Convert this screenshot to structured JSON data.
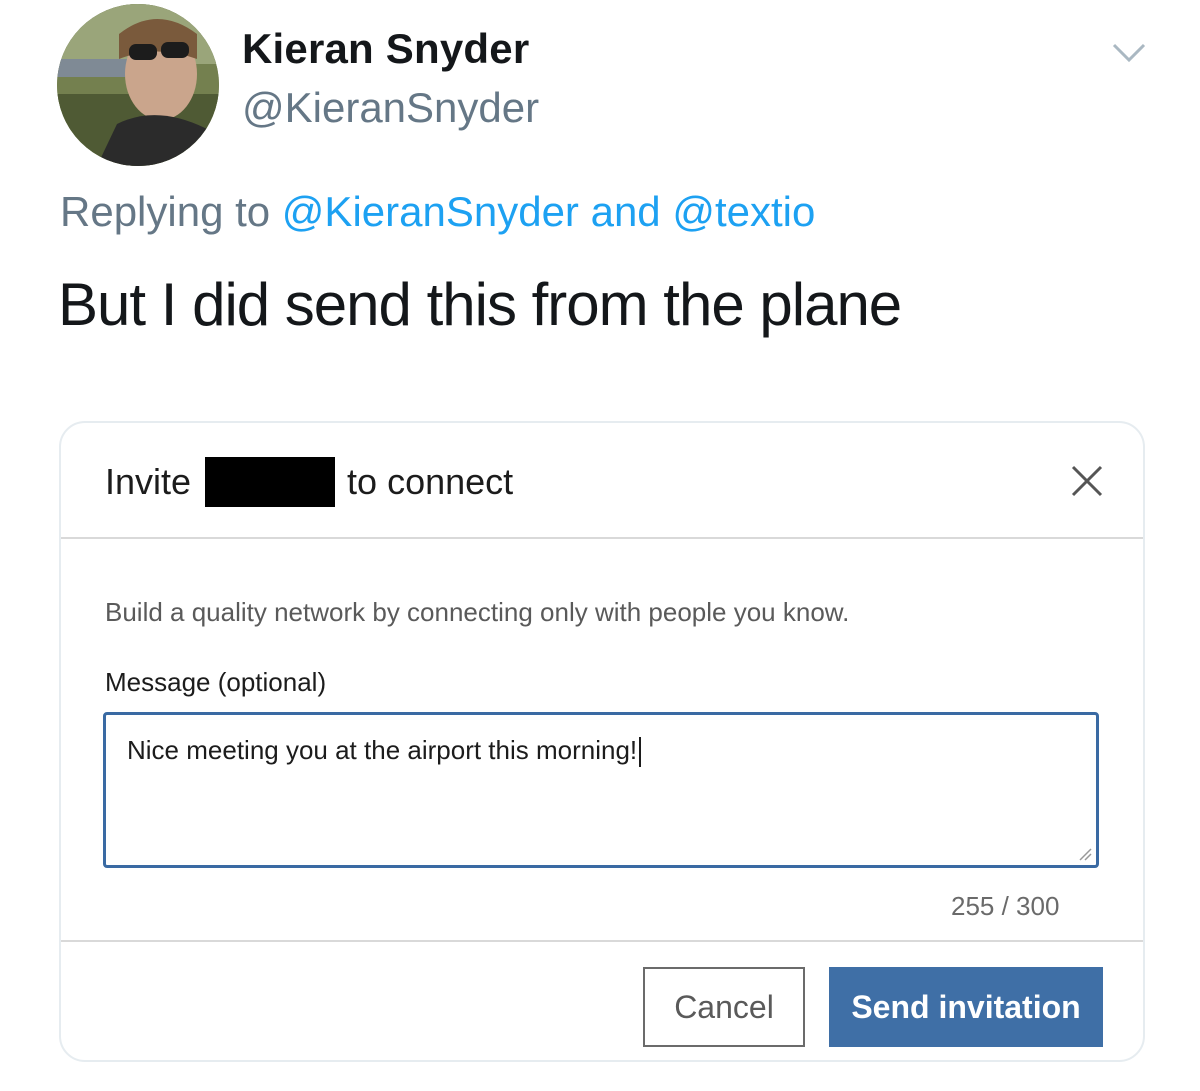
{
  "tweet": {
    "author_name": "Kieran Snyder",
    "author_handle": "@KieranSnyder",
    "reply": {
      "prefix": "Replying to",
      "mention_1": "@KieranSnyder",
      "conjunction": "and",
      "mention_2": "@textio"
    },
    "text": "But I did send this from the plane",
    "colors": {
      "link": "#1da1f2",
      "muted": "#657786",
      "text": "#14171a"
    }
  },
  "modal": {
    "title_prefix": "Invite",
    "title_suffix": "to connect",
    "helper_text": "Build a quality network by connecting only with people you know.",
    "message_label": "Message (optional)",
    "message_value": "Nice meeting you at the airport this morning!",
    "char_counter": "255 / 300",
    "cancel_label": "Cancel",
    "send_label": "Send invitation",
    "colors": {
      "primary": "#3f6fa6",
      "focus_border": "#3a6aa3"
    },
    "icons": {
      "close": "close-icon",
      "menu": "chevron-down-icon"
    }
  }
}
